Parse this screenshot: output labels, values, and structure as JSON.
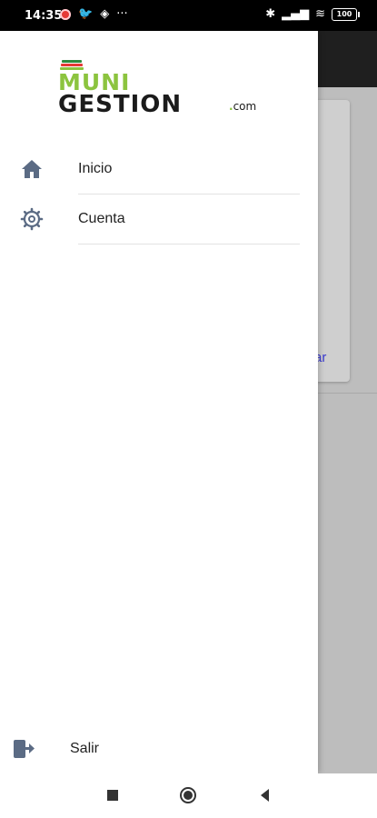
{
  "status_bar": {
    "time": "14:35",
    "left_icons": [
      "record-icon",
      "twitter-icon",
      "diamond-icon",
      "more-icon"
    ],
    "right_icons": [
      "bluetooth-icon",
      "signal-icon",
      "wifi-icon",
      "battery-icon"
    ],
    "battery_level": "100"
  },
  "logo": {
    "line1": "MUNI",
    "line2": "GESTION",
    "suffix_dot": ".",
    "suffix": "com"
  },
  "drawer": {
    "items": [
      {
        "label": "Inicio",
        "icon": "home-icon"
      },
      {
        "label": "Cuenta",
        "icon": "gear-icon"
      }
    ],
    "logout": {
      "label": "Salir",
      "icon": "logout-icon"
    }
  },
  "background": {
    "card_link_text": "ar"
  },
  "colors": {
    "brand_green": "#8cc43f",
    "icon_slate": "#5b6b84",
    "link_blue": "#3b3bd1"
  }
}
